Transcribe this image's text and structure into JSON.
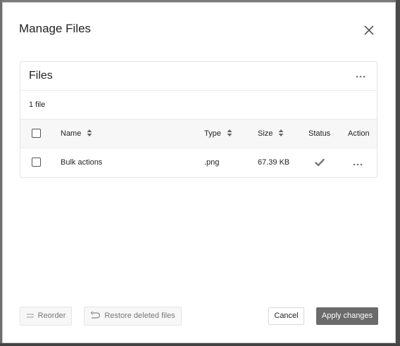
{
  "modal": {
    "title": "Manage Files",
    "close_icon": "close-icon"
  },
  "files_card": {
    "title": "Files",
    "menu_icon": "more-horizontal-icon",
    "file_count": "1 file"
  },
  "table": {
    "columns": {
      "name": "Name",
      "type": "Type",
      "size": "Size",
      "status": "Status",
      "action": "Action"
    },
    "rows": [
      {
        "name": "Bulk actions",
        "type": ".png",
        "size": "67.39 KB",
        "status_icon": "checkmark-icon",
        "action_icon": "more-horizontal-icon",
        "checked": false
      }
    ]
  },
  "footer": {
    "reorder_label": "Reorder",
    "restore_label": "Restore deleted files",
    "cancel_label": "Cancel",
    "apply_label": "Apply changes"
  },
  "colors": {
    "primary_button": "#6b6b6b",
    "overlay": "#5a5a5a",
    "border": "#e3e3e3"
  }
}
